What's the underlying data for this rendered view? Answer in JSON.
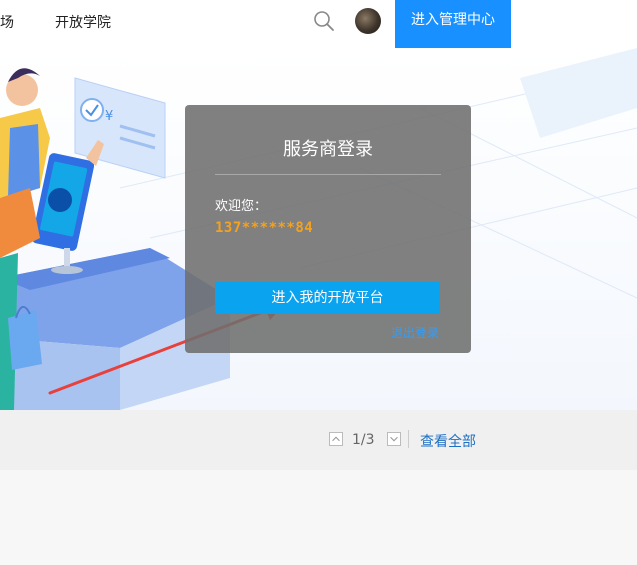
{
  "nav": {
    "partial_item": "场",
    "academy": "开放学院",
    "admin_button": "进入管理中心"
  },
  "icons": {
    "search": "search-icon",
    "avatar": "avatar",
    "page_up": "chevron-up-icon",
    "page_down": "chevron-down-icon"
  },
  "banner": {
    "price_symbol": "¥"
  },
  "login_card": {
    "title": "服务商登录",
    "welcome": "欢迎您：",
    "phone": "137******84",
    "enter_button": "进入我的开放平台",
    "logout": "退出登录"
  },
  "pager": {
    "page_indicator": "1/3",
    "view_all": "查看全部"
  },
  "colors": {
    "accent": "#1890ff",
    "enter_button": "#0aa3f0",
    "phone": "#f5a21b",
    "arrow": "#e8413c",
    "link": "#1d6fc4"
  }
}
